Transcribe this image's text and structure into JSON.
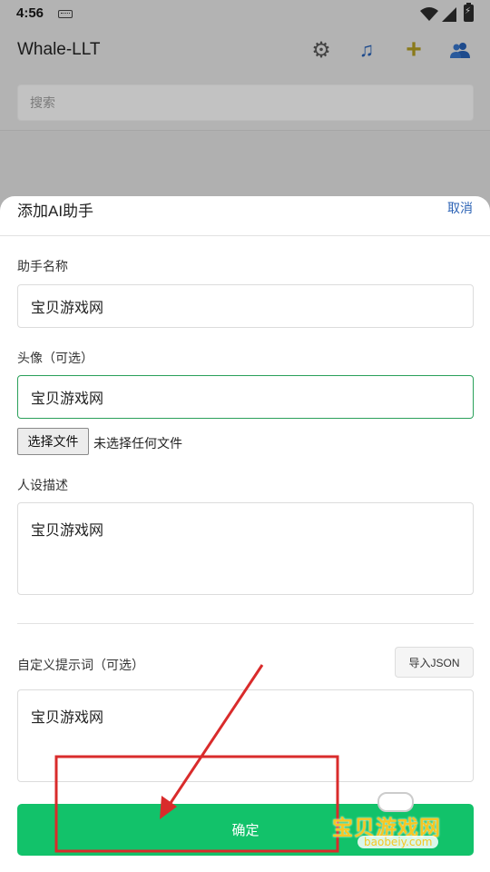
{
  "status_bar": {
    "time": "4:56"
  },
  "app_bar": {
    "title": "Whale-LLT",
    "icons": [
      "gear-icon",
      "music-icon",
      "plus-icon",
      "users-icon"
    ]
  },
  "search": {
    "placeholder": "搜索"
  },
  "sheet": {
    "title": "添加AI助手",
    "cancel_label": "取消",
    "name_label": "助手名称",
    "name_value": "宝贝游戏网",
    "avatar_label": "头像（可选）",
    "avatar_value": "宝贝游戏网",
    "file_button_label": "选择文件",
    "file_status": "未选择任何文件",
    "persona_label": "人设描述",
    "persona_value": "宝贝游戏网",
    "prompt_label": "自定义提示词（可选）",
    "import_json_label": "导入JSON",
    "prompt_value": "宝贝游戏网",
    "confirm_label": "确定"
  },
  "watermark": {
    "text": "宝贝游戏网",
    "url": "baobeiy.com"
  },
  "colors": {
    "primary": "#12c26a",
    "link": "#2c63b5",
    "focus_border": "#2aa05a",
    "annotation": "#d92b2b"
  }
}
